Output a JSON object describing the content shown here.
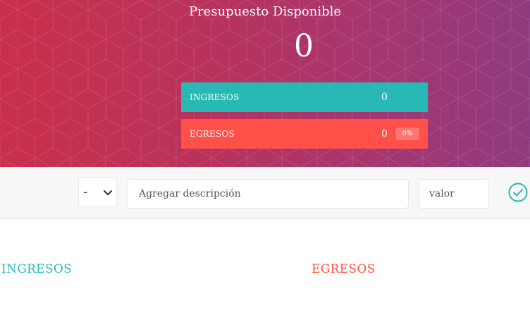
{
  "budget": {
    "title": "Presupuesto Disponible",
    "value": "0"
  },
  "summary": {
    "income": {
      "label": "INGRESOS",
      "value": "0",
      "color": "#28b9b5"
    },
    "expense": {
      "label": "EGRESOS",
      "value": "0",
      "percentage": "0%",
      "color": "#ff5049"
    }
  },
  "add_form": {
    "type_selected": "-",
    "description_placeholder": "Agregar descripción",
    "value_placeholder": "valor",
    "submit_icon": "checkmark-circle-icon"
  },
  "lists": {
    "income_title": "INGRESOS",
    "expense_title": "EGRESOS"
  },
  "colors": {
    "gradient_start": "#c9304a",
    "gradient_end": "#8f3a7e",
    "income": "#28b9b5",
    "expense": "#ff5049"
  }
}
